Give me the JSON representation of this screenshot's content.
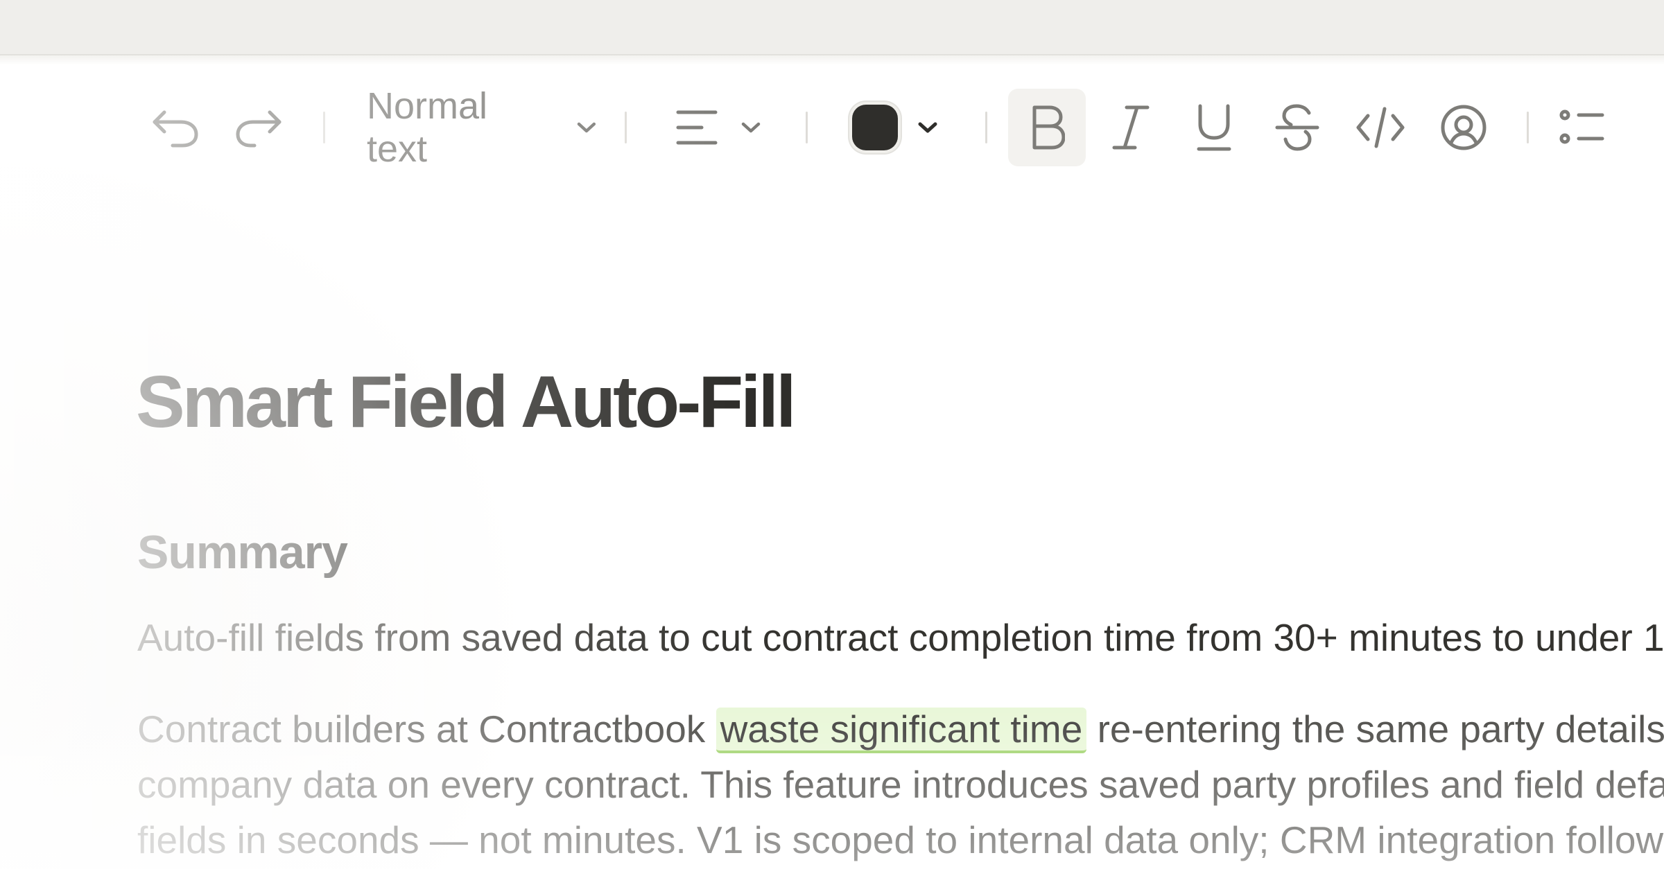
{
  "toolbar": {
    "text_style": "Normal text",
    "text_color": "#2f2e2b"
  },
  "document": {
    "title": "Smart Field Auto-Fill",
    "summary_heading": "Summary",
    "summary_text": "Auto-fill fields from saved data to cut contract completion time from 30+ minutes to under 1",
    "body_line1_before": "Contract builders at Contractbook ",
    "body_line1_highlight": "waste significant time",
    "body_line1_after": " re-entering the same party details",
    "body_line2": "company data on every contract. This feature introduces saved party profiles and field defa",
    "body_line3": "fields in seconds — not minutes. V1 is scoped to internal data only; CRM integration follows"
  },
  "colors": {
    "highlight_bg": "#e6f6d3",
    "highlight_underline": "#96cf5d"
  }
}
